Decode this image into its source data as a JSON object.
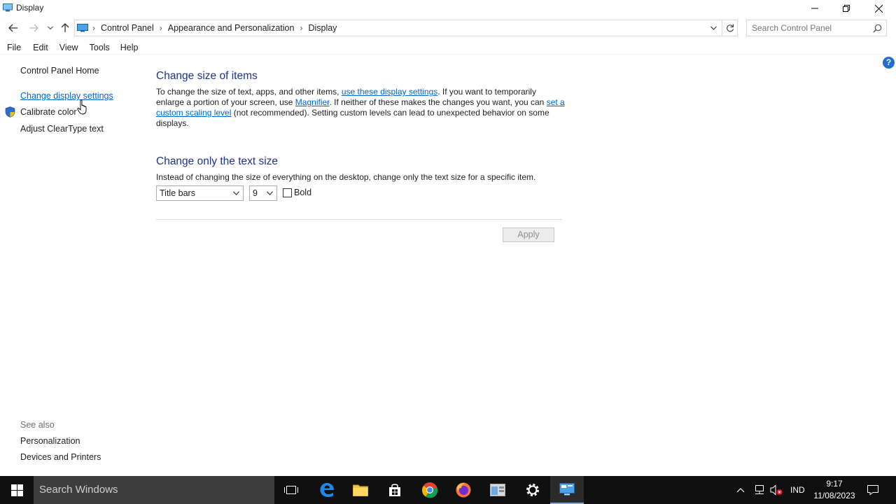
{
  "window": {
    "title": "Display"
  },
  "address": {
    "crumbs": [
      "Control Panel",
      "Appearance and Personalization",
      "Display"
    ],
    "search_placeholder": "Search Control Panel"
  },
  "menu": [
    "File",
    "Edit",
    "View",
    "Tools",
    "Help"
  ],
  "sidebar": {
    "home": "Control Panel Home",
    "items": [
      "Change display settings",
      "Calibrate color",
      "Adjust ClearType text"
    ],
    "see_also_label": "See also",
    "see_also": [
      "Personalization",
      "Devices and Printers"
    ]
  },
  "help_icon_text": "?",
  "main": {
    "section1": {
      "heading": "Change size of items",
      "text_a": "To change the size of text, apps, and other items, ",
      "link_a": "use these display settings",
      "text_b": ".  If you want to temporarily enlarge a portion of your screen, use ",
      "link_b": "Magnifier",
      "text_c": ".  If neither of these makes the changes you want, you can ",
      "link_c": "set a custom scaling level",
      "text_d": " (not recommended).  Setting custom levels can lead to unexpected behavior on some displays."
    },
    "section2": {
      "heading": "Change only the text size",
      "text": "Instead of changing the size of everything on the desktop, change only the text size for a specific item."
    },
    "item_select": "Title bars",
    "size_select": "9",
    "bold_label": "Bold",
    "bold_checked": false,
    "apply_label": "Apply"
  },
  "taskbar": {
    "search_placeholder": "Search Windows",
    "language": "IND",
    "time": "9:17",
    "date": "11/08/2023"
  },
  "colors": {
    "heading": "#1e3287",
    "link": "#0066cc",
    "taskbar": "#101010"
  }
}
